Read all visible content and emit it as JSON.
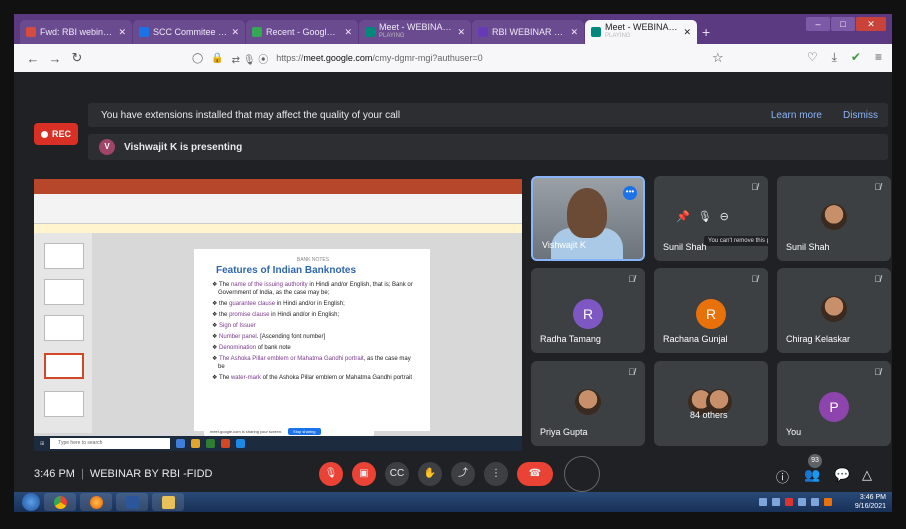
{
  "browser": {
    "tabs": [
      {
        "label": "Fwd: RBI webinar - pradn",
        "color": "#d54b3d"
      },
      {
        "label": "SCC Commitee - Google",
        "color": "#1a73e8"
      },
      {
        "label": "Recent - Google Drive",
        "color": "#34a853"
      },
      {
        "label": "Meet - WEBINAR BY RBI -",
        "sub": "PLAYING",
        "color": "#00897b"
      },
      {
        "label": "RBI WEBINAR FEEDBACK",
        "color": "#673ab7"
      },
      {
        "label": "Meet - WEBINAR BY RBI -",
        "sub": "PLAYING",
        "color": "#00897b",
        "active": true
      }
    ],
    "url_prefix": "https://",
    "url_host": "meet.google.com",
    "url_path": "/cmy-dgmr-mgi?authuser=0"
  },
  "meet": {
    "rec_label": "REC",
    "extension_banner": "You have extensions installed that may affect the quality of your call",
    "learn_more": "Learn more",
    "dismiss": "Dismiss",
    "presenter_initial": "V",
    "presenting_text": "Vishwajit K is presenting",
    "slide": {
      "header": "BANK NOTES",
      "title": "Features of Indian Banknotes",
      "items": [
        {
          "pre": "The ",
          "hl": "name of the issuing authority",
          "post": " in Hindi and/or English, that is; Bank or Government of India, as the case may be;"
        },
        {
          "pre": "the ",
          "hl": "guarantee clause",
          "post": " in Hindi and/or in English;"
        },
        {
          "pre": "the ",
          "hl": "promise clause",
          "post": " in Hindi and/or in English;"
        },
        {
          "pre": "",
          "hl": "Sign of Issuer",
          "post": ""
        },
        {
          "pre": "",
          "hl": "Number panel",
          "post": ". [Ascending font number]"
        },
        {
          "pre": "",
          "hl": "Denomination",
          "post": " of bank note"
        },
        {
          "pre": "",
          "hl": "The Ashoka Pillar emblem or Mahatma Gandhi portrait",
          "post": ", as the case may be"
        },
        {
          "pre": "The ",
          "hl": "water-mark",
          "post": " of the Ashoka Pillar emblem or Mahatma Gandhi portrait"
        }
      ],
      "share_notice": "meet.google.com is sharing your screen.",
      "stop_sharing": "Stop sharing",
      "search_placeholder": "Type here to search"
    },
    "participants": [
      {
        "name": "Vishwajit K"
      },
      {
        "name": "Sunil Shah",
        "tooltip": "You can't remove this participant"
      },
      {
        "name": "Sunil Shah"
      },
      {
        "name": "Radha Tamang",
        "initial": "R",
        "color": "#7e57c2"
      },
      {
        "name": "Rachana Gunjal",
        "initial": "R",
        "color": "#e8710a"
      },
      {
        "name": "Chirag Kelaskar"
      },
      {
        "name": "Priya Gupta"
      },
      {
        "name": "84 others"
      },
      {
        "name": "You",
        "initial": "P",
        "color": "#8e44ad"
      }
    ],
    "time": "3:46 PM",
    "meeting_name": "WEBINAR BY RBI -FIDD",
    "participant_count": "93"
  },
  "taskbar": {
    "time": "3:46 PM",
    "date": "9/16/2021"
  }
}
